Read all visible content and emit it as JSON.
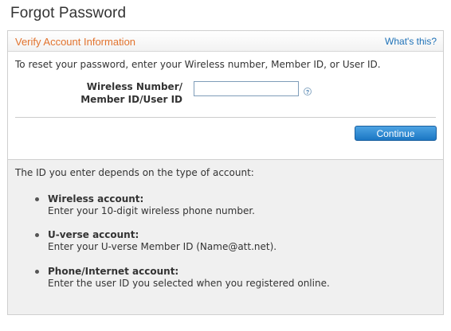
{
  "page": {
    "title": "Forgot Password"
  },
  "panel": {
    "title": "Verify Account Information",
    "help_link": "What's this?",
    "intro": "To reset your password, enter your Wireless number, Member ID, or User ID.",
    "field_label_line1": "Wireless Number/",
    "field_label_line2": "Member ID/User ID",
    "input_value": "",
    "input_placeholder": "",
    "help_icon": "question-mark-icon",
    "continue_label": "Continue"
  },
  "info": {
    "intro": "The ID you enter depends on the type of account:",
    "accounts": [
      {
        "title": "Wireless account:",
        "description": "Enter your 10-digit wireless phone number."
      },
      {
        "title": "U-verse account:",
        "description": "Enter your U-verse Member ID (Name@att.net)."
      },
      {
        "title": "Phone/Internet account:",
        "description": "Enter the user ID you selected when you registered online."
      }
    ]
  },
  "colors": {
    "accent_orange": "#e2732e",
    "link_blue": "#1f72b8",
    "button_blue": "#1b77c4",
    "lower_background": "#f0f0f0"
  }
}
